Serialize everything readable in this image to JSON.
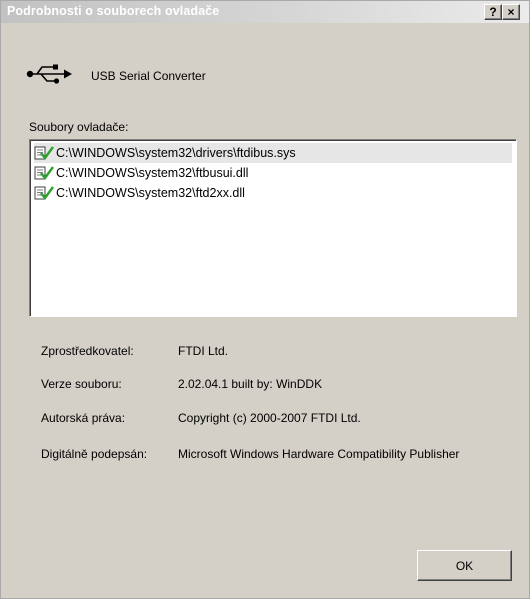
{
  "window": {
    "title": "Podrobnosti o souborech ovladače",
    "help_button": "?",
    "close_button": "×"
  },
  "device": {
    "icon": "usb-icon",
    "name": "USB Serial Converter"
  },
  "files": {
    "label": "Soubory ovladače:",
    "items": [
      {
        "icon": "signed-driver-file-icon",
        "path": "C:\\WINDOWS\\system32\\drivers\\ftdibus.sys",
        "selected": true
      },
      {
        "icon": "signed-driver-file-icon",
        "path": "C:\\WINDOWS\\system32\\ftbusui.dll",
        "selected": false
      },
      {
        "icon": "signed-driver-file-icon",
        "path": "C:\\WINDOWS\\system32\\ftd2xx.dll",
        "selected": false
      }
    ]
  },
  "properties": {
    "provider": {
      "label": "Zprostředkovatel:",
      "value": "FTDI Ltd."
    },
    "file_version": {
      "label": "Verze souboru:",
      "value": "2.02.04.1 built by: WinDDK"
    },
    "copyright": {
      "label": "Autorská práva:",
      "value": "Copyright (c) 2000-2007 FTDI Ltd."
    },
    "digital_signer": {
      "label": "Digitálně podepsán:",
      "value": "Microsoft Windows Hardware Compatibility Publisher"
    }
  },
  "buttons": {
    "ok_label": "OK"
  },
  "colors": {
    "dialog_bg": "#d4d0c8",
    "list_bg": "#ffffff",
    "selected_row": "#e6e6e6",
    "check_green": "#2fa12f"
  }
}
